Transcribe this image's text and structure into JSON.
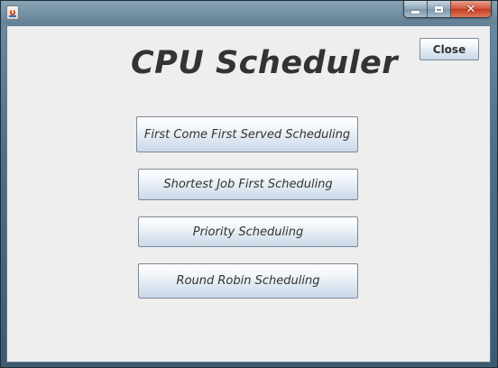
{
  "window": {
    "title": "",
    "controls": {
      "minimize": "minimize",
      "maximize": "maximize",
      "close": "✕"
    }
  },
  "app": {
    "heading": "CPU Scheduler",
    "close_label": "Close",
    "buttons": [
      {
        "label": "First Come First Served Scheduling"
      },
      {
        "label": "Shortest Job First Scheduling"
      },
      {
        "label": "Priority Scheduling"
      },
      {
        "label": "Round Robin Scheduling"
      }
    ]
  }
}
